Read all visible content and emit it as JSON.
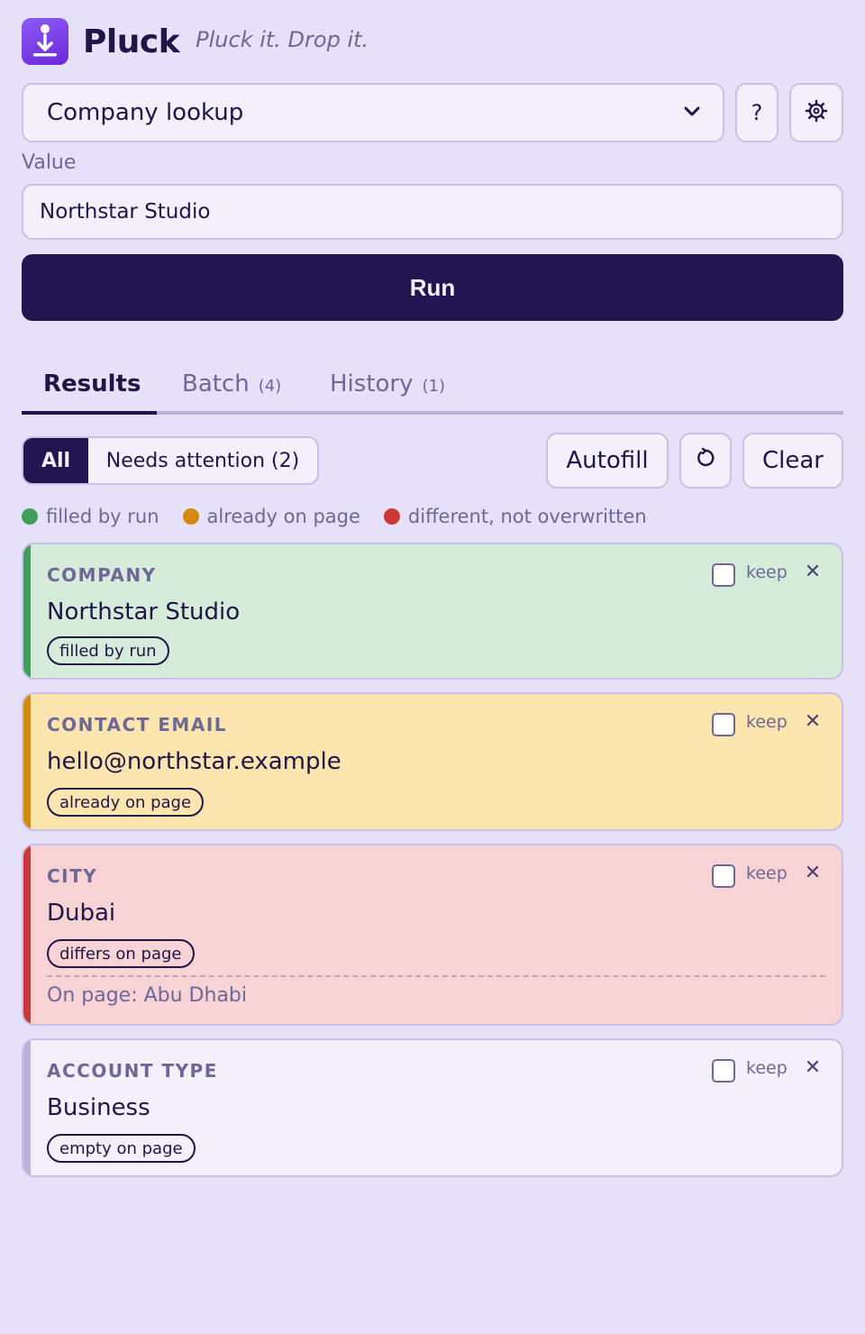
{
  "app": {
    "name": "Pluck",
    "tagline": "Pluck it. Drop it.",
    "logo_icon": "download-icon"
  },
  "preset": {
    "selected": "Company lookup",
    "help_label": "?",
    "settings_icon": "gear-icon"
  },
  "value_field": {
    "label": "Value",
    "value": "Northstar Studio"
  },
  "run_label": "Run",
  "tabs": [
    {
      "label": "Results",
      "count": ""
    },
    {
      "label": "Batch",
      "count": "(4)"
    },
    {
      "label": "History",
      "count": "(1)"
    }
  ],
  "filters": {
    "all_label": "All",
    "needs_attention_label": "Needs attention (2)"
  },
  "actions": {
    "autofill_label": "Autofill",
    "refresh_icon": "refresh-icon",
    "clear_label": "Clear"
  },
  "legend": [
    {
      "label": "filled by run",
      "color": "#3f9f5a"
    },
    {
      "label": "already on page",
      "color": "#d48a0e"
    },
    {
      "label": "different, not overwritten",
      "color": "#c93a36"
    }
  ],
  "results": [
    {
      "field": "COMPANY",
      "value": "Northstar Studio",
      "status": "filled by run",
      "keep_label": "keep",
      "keep": false,
      "color": "#3f9f5a"
    },
    {
      "field": "CONTACT EMAIL",
      "value": "hello@northstar.example",
      "status": "already on page",
      "keep_label": "keep",
      "keep": false,
      "color": "#d48a0e"
    },
    {
      "field": "CITY",
      "value": "Dubai",
      "status": "differs on page",
      "keep_label": "keep",
      "keep": false,
      "on_page": "On page: Abu Dhabi",
      "color": "#c93a36"
    },
    {
      "field": "ACCOUNT TYPE",
      "value": "Business",
      "status": "empty on page",
      "keep_label": "keep",
      "keep": false,
      "color": "#bcb3dc"
    }
  ]
}
